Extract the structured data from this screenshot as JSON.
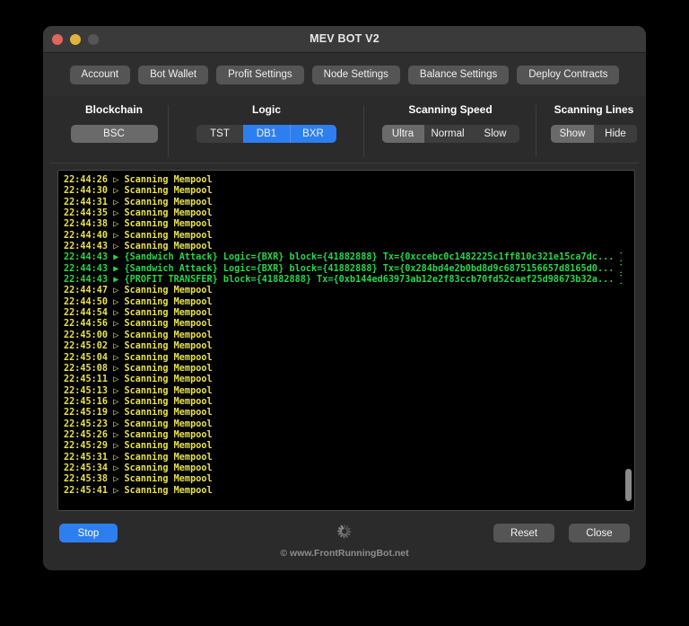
{
  "window": {
    "title": "MEV BOT V2",
    "traffic_lights": [
      "close-red",
      "minimize-yellow",
      "zoom-gray"
    ]
  },
  "toolbar": {
    "buttons": [
      {
        "label": "Account"
      },
      {
        "label": "Bot Wallet"
      },
      {
        "label": "Profit Settings"
      },
      {
        "label": "Node Settings"
      },
      {
        "label": "Balance Settings"
      },
      {
        "label": "Deploy Contracts"
      }
    ]
  },
  "settings": {
    "blockchain": {
      "label": "Blockchain",
      "options": [
        {
          "label": "BSC",
          "state": "selected"
        }
      ]
    },
    "logic": {
      "label": "Logic",
      "options": [
        {
          "label": "TST",
          "state": "inactive"
        },
        {
          "label": "DB1",
          "state": "active"
        },
        {
          "label": "BXR",
          "state": "active"
        }
      ]
    },
    "scanning_speed": {
      "label": "Scanning Speed",
      "options": [
        {
          "label": "Ultra",
          "state": "selected"
        },
        {
          "label": "Normal",
          "state": "unselected"
        },
        {
          "label": "Slow",
          "state": "unselected"
        }
      ]
    },
    "scanning_lines": {
      "label": "Scanning Lines",
      "options": [
        {
          "label": "Show",
          "state": "selected"
        },
        {
          "label": "Hide",
          "state": "unselected"
        }
      ]
    }
  },
  "terminal": {
    "lines": [
      {
        "type": "scan",
        "text": "22:44:26 ▷ Scanning Mempool"
      },
      {
        "type": "scan",
        "text": "22:44:30 ▷ Scanning Mempool"
      },
      {
        "type": "scan",
        "text": "22:44:31 ▷ Scanning Mempool"
      },
      {
        "type": "scan",
        "text": "22:44:35 ▷ Scanning Mempool"
      },
      {
        "type": "scan",
        "text": "22:44:38 ▷ Scanning Mempool"
      },
      {
        "type": "scan",
        "text": "22:44:40 ▷ Scanning Mempool"
      },
      {
        "type": "scan",
        "text": "22:44:43 ▷ Scanning Mempool"
      },
      {
        "type": "hit",
        "text": "22:44:43 ▶ {Sandwich Attack} Logic={BXR} block={41882888} Tx={0xccebc0c1482225c1ff810c321e15ca7dc... }"
      },
      {
        "type": "hit",
        "text": "22:44:43 ▶ {Sandwich Attack} Logic={BXR} block={41882888} Tx={0x284bd4e2b0bd8d9c6875156657d8165d0... }"
      },
      {
        "type": "hit",
        "text": "22:44:43 ▶ {PROFIT TRANSFER} block={41882888} Tx={0xb144ed63973ab12e2f83ccb70fd52caef25d98673b32a... }"
      },
      {
        "type": "scan",
        "text": "22:44:47 ▷ Scanning Mempool"
      },
      {
        "type": "scan",
        "text": "22:44:50 ▷ Scanning Mempool"
      },
      {
        "type": "scan",
        "text": "22:44:54 ▷ Scanning Mempool"
      },
      {
        "type": "scan",
        "text": "22:44:56 ▷ Scanning Mempool"
      },
      {
        "type": "scan",
        "text": "22:45:00 ▷ Scanning Mempool"
      },
      {
        "type": "scan",
        "text": "22:45:02 ▷ Scanning Mempool"
      },
      {
        "type": "scan",
        "text": "22:45:04 ▷ Scanning Mempool"
      },
      {
        "type": "scan",
        "text": "22:45:08 ▷ Scanning Mempool"
      },
      {
        "type": "scan",
        "text": "22:45:11 ▷ Scanning Mempool"
      },
      {
        "type": "scan",
        "text": "22:45:13 ▷ Scanning Mempool"
      },
      {
        "type": "scan",
        "text": "22:45:16 ▷ Scanning Mempool"
      },
      {
        "type": "scan",
        "text": "22:45:19 ▷ Scanning Mempool"
      },
      {
        "type": "scan",
        "text": "22:45:23 ▷ Scanning Mempool"
      },
      {
        "type": "scan",
        "text": "22:45:26 ▷ Scanning Mempool"
      },
      {
        "type": "scan",
        "text": "22:45:29 ▷ Scanning Mempool"
      },
      {
        "type": "scan",
        "text": "22:45:31 ▷ Scanning Mempool"
      },
      {
        "type": "scan",
        "text": "22:45:34 ▷ Scanning Mempool"
      },
      {
        "type": "scan",
        "text": "22:45:38 ▷ Scanning Mempool"
      },
      {
        "type": "scan",
        "text": "22:45:41 ▷ Scanning Mempool"
      }
    ]
  },
  "footer": {
    "stop_label": "Stop",
    "reset_label": "Reset",
    "close_label": "Close",
    "copyright": "© www.FrontRunningBot.net",
    "spinner": "loading-spinner-icon"
  },
  "colors": {
    "accent_blue": "#2d7ff0",
    "scan_yellow": "#e8e14a",
    "hit_green": "#24d84a",
    "window_bg": "#2b2b2b",
    "terminal_bg": "#000000"
  }
}
